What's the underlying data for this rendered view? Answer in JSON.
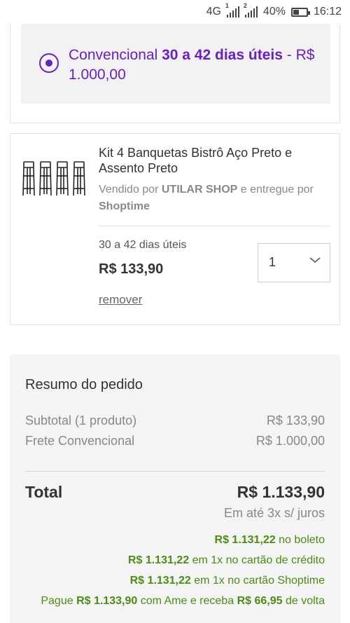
{
  "status_bar": {
    "network": "4G",
    "sim1": "1",
    "sim2": "2",
    "battery": "40%",
    "time": "16:12"
  },
  "shipping_option": {
    "name": "Convencional",
    "deadline": "30 a 42 dias úteis",
    "separator": "-",
    "price": "R$ 1.000,00",
    "selected": true,
    "accent_color": "#6a1ec7"
  },
  "product": {
    "title": "Kit 4 Banquetas Bistrô Aço Preto e Assento Preto",
    "sold_by_prefix": "Vendido por",
    "seller": "UTILAR SHOP",
    "delivered_by_prefix": "e entregue por",
    "delivered_by": "Shoptime",
    "deadline": "30 a 42 dias úteis",
    "price": "R$ 133,90",
    "quantity": "1",
    "remove_label": "remover",
    "image_icon": "bar-stools-icon"
  },
  "summary": {
    "title": "Resumo do pedido",
    "subtotal_label": "Subtotal (1 produto)",
    "subtotal_value": "R$ 133,90",
    "shipping_label": "Frete Convencional",
    "shipping_value": "R$ 1.000,00",
    "total_label": "Total",
    "total_value": "R$ 1.133,90",
    "installments": "Em até 3x s/ juros",
    "boleto_value": "R$ 1.131,22",
    "boleto_suffix": "no boleto",
    "credit_value": "R$ 1.131,22",
    "credit_suffix": "em 1x no cartão de crédito",
    "shoptime_value": "R$ 1.131,22",
    "shoptime_suffix": "em 1x no cartão Shoptime",
    "ame_prefix": "Pague",
    "ame_value": "R$ 1.133,90",
    "ame_middle": "com Ame e receba",
    "ame_cashback": "R$ 66,95",
    "ame_suffix": "de volta",
    "green_color": "#4c8c12"
  }
}
